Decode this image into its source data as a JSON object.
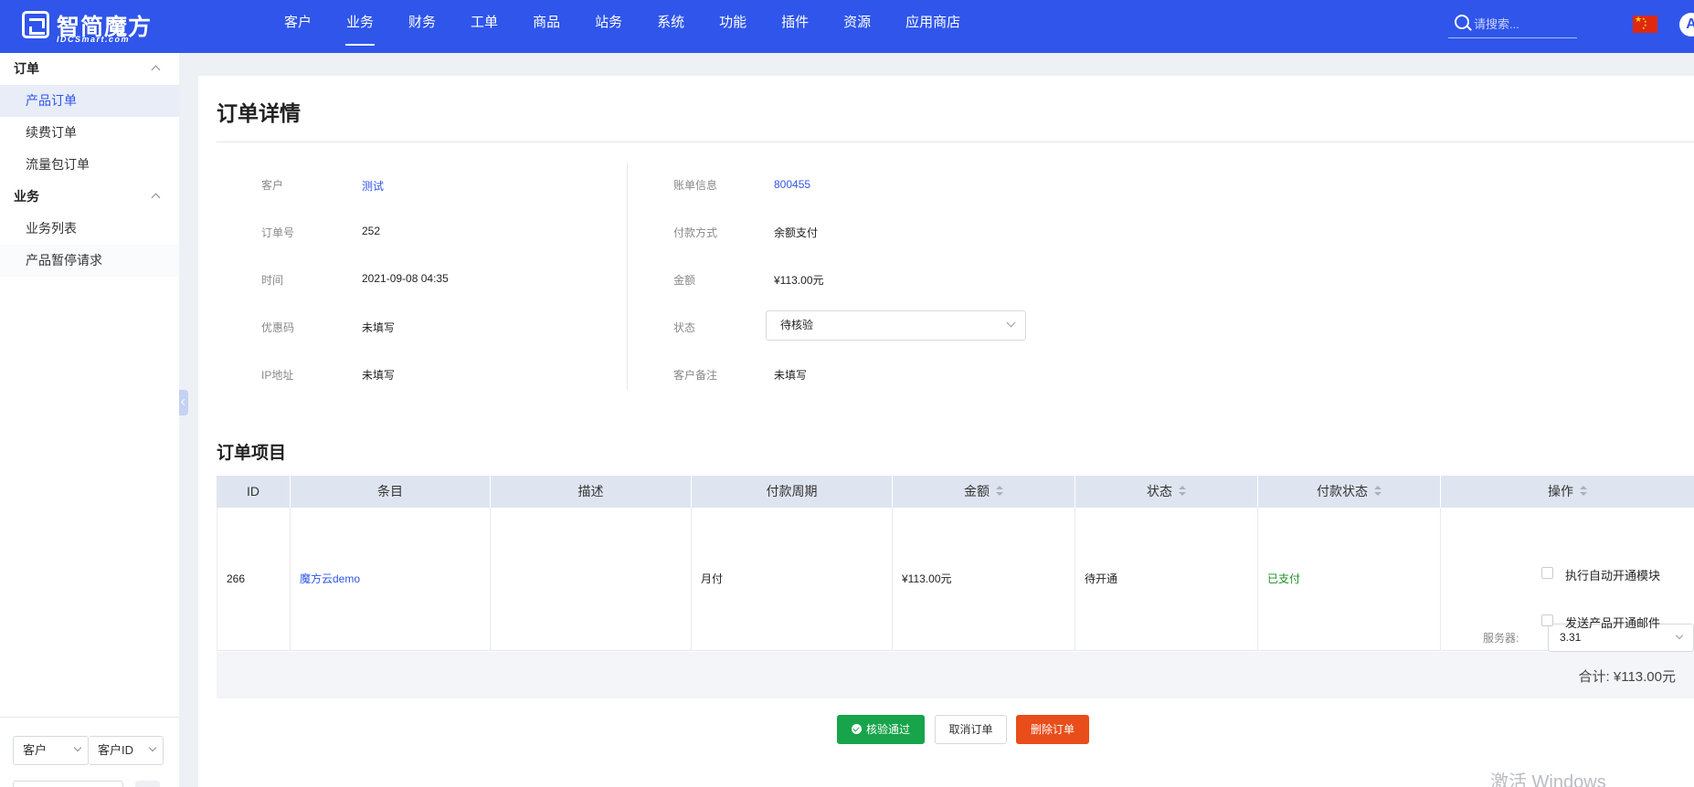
{
  "header": {
    "logo_cn": "智简魔方",
    "logo_en": "IDCSmart.com",
    "nav": [
      "客户",
      "业务",
      "财务",
      "工单",
      "商品",
      "站务",
      "系统",
      "功能",
      "插件",
      "资源",
      "应用商店"
    ],
    "active_nav": "业务",
    "search_placeholder": "请搜索...",
    "avatar_letter": "A",
    "colors": {
      "brand": "#2f55ea"
    }
  },
  "sidebar": {
    "groups": [
      {
        "title": "订单",
        "items": [
          "产品订单",
          "续费订单",
          "流量包订单"
        ]
      },
      {
        "title": "业务",
        "items": [
          "业务列表",
          "产品暂停请求"
        ]
      }
    ],
    "active_item": "产品订单",
    "filter_selects": [
      "客户",
      "客户ID"
    ]
  },
  "page": {
    "title": "订单详情",
    "left_fields": [
      {
        "label": "客户",
        "value": "测试"
      },
      {
        "label": "订单号",
        "value": "252"
      },
      {
        "label": "时间",
        "value": "2021-09-08 04:35"
      },
      {
        "label": "优惠码",
        "value": "未填写"
      },
      {
        "label": "IP地址",
        "value": "未填写"
      }
    ],
    "right_fields": [
      {
        "label": "账单信息",
        "value": "800455"
      },
      {
        "label": "付款方式",
        "value": "余额支付"
      },
      {
        "label": "金额",
        "value": "¥113.00元"
      },
      {
        "label": "状态",
        "value": "待核验"
      },
      {
        "label": "客户备注",
        "value": "未填写"
      }
    ]
  },
  "items_section": {
    "title": "订单项目",
    "columns": [
      "ID",
      "条目",
      "描述",
      "付款周期",
      "金额",
      "状态",
      "付款状态",
      "操作"
    ],
    "row": {
      "id": "266",
      "item": "魔方云demo",
      "description": "",
      "cycle": "月付",
      "amount": "¥113.00元",
      "status": "待开通",
      "pay_status": "已支付"
    },
    "server_label": "服务器:",
    "server_value": "3.31",
    "checkbox_auto": "执行自动开通模块",
    "checkbox_mail": "发送产品开通邮件",
    "total": "合计: ¥113.00元",
    "status_colors": {
      "paid": "#1b8f25"
    }
  },
  "actions": {
    "approve": "核验通过",
    "cancel": "取消订单",
    "delete": "删除订单",
    "colors": {
      "approve": "#17a44a",
      "delete": "#e84d1a"
    }
  },
  "watermark": "激活 Windows"
}
